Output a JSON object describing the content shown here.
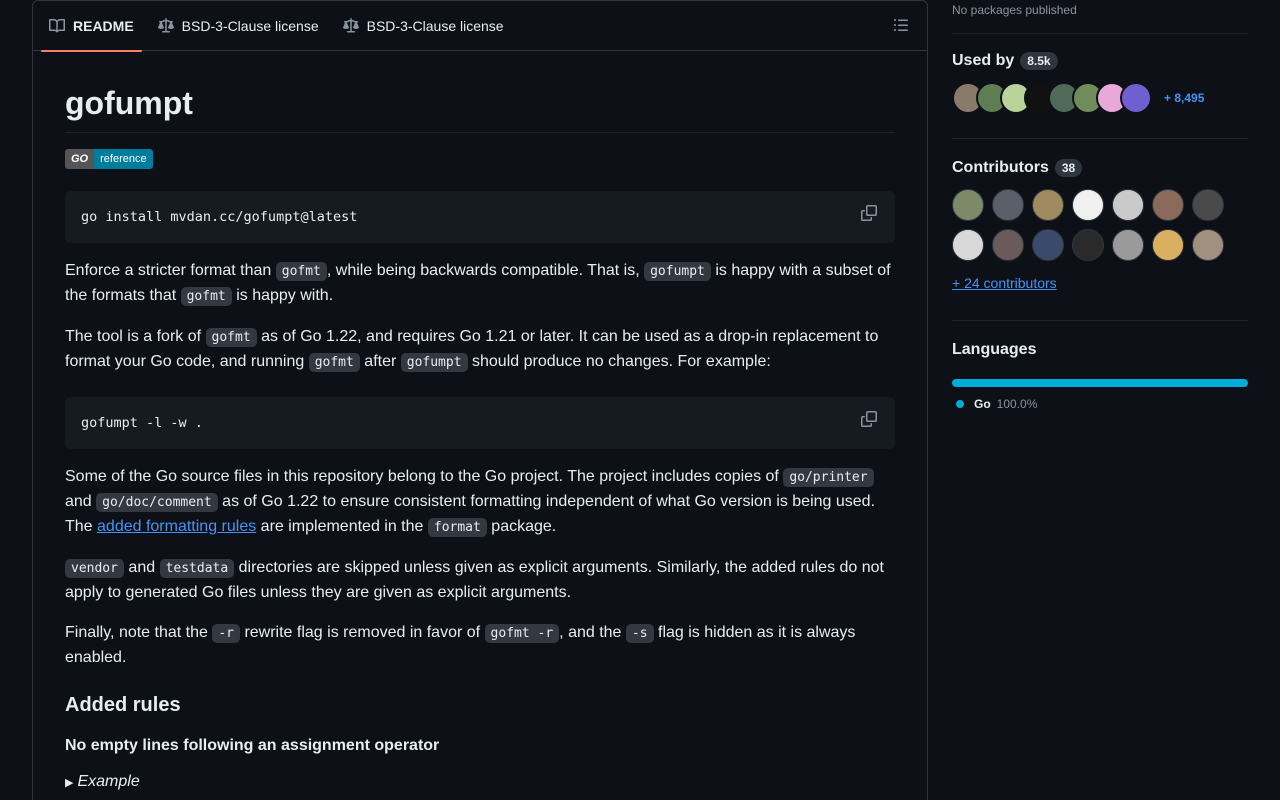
{
  "readme": {
    "tabs": [
      {
        "label": "README",
        "icon": "book-icon"
      },
      {
        "label": "BSD-3-Clause license",
        "icon": "law-icon"
      },
      {
        "label": "BSD-3-Clause license",
        "icon": "law-icon"
      }
    ],
    "title": "gofumpt",
    "badge": {
      "left": "GO",
      "right": "reference"
    },
    "code1": "go install mvdan.cc/gofumpt@latest",
    "p1": {
      "a": "Enforce a stricter format than ",
      "c1": "gofmt",
      "b": ", while being backwards compatible. That is, ",
      "c2": "gofumpt",
      "c": " is happy with a subset of the formats that ",
      "c3": "gofmt",
      "d": " is happy with."
    },
    "p2": {
      "a": "The tool is a fork of ",
      "c1": "gofmt",
      "b": " as of Go 1.22, and requires Go 1.21 or later. It can be used as a drop-in replacement to format your Go code, and running ",
      "c2": "gofmt",
      "c": " after ",
      "c3": "gofumpt",
      "d": " should produce no changes. For example:"
    },
    "code2": "gofumpt -l -w .",
    "p3": {
      "a": "Some of the Go source files in this repository belong to the Go project. The project includes copies of ",
      "c1": "go/printer",
      "b": " and ",
      "c2": "go/doc/comment",
      "c": " as of Go 1.22 to ensure consistent formatting independent of what Go version is being used. The ",
      "link": "added formatting rules",
      "d": " are implemented in the ",
      "c3": "format",
      "e": " package."
    },
    "p4": {
      "c1": "vendor",
      "a": " and ",
      "c2": "testdata",
      "b": " directories are skipped unless given as explicit arguments. Similarly, the added rules do not apply to generated Go files unless they are given as explicit arguments."
    },
    "p5": {
      "a": "Finally, note that the ",
      "c1": "-r",
      "b": " rewrite flag is removed in favor of ",
      "c2": "gofmt -r",
      "c": ", and the ",
      "c3": "-s",
      "d": " flag is hidden as it is always enabled."
    },
    "h2": "Added rules",
    "h3": "No empty lines following an assignment operator",
    "details": "Example"
  },
  "sidebar": {
    "packages_text": "No packages published",
    "used_by": {
      "label": "Used by",
      "count": "8.5k",
      "more": "+ 8,495"
    },
    "contributors": {
      "label": "Contributors",
      "count": "38",
      "more": "+ 24 contributors"
    },
    "languages": {
      "label": "Languages",
      "items": [
        {
          "name": "Go",
          "percent": "100.0%",
          "color": "#00add8"
        }
      ]
    }
  },
  "colors": {
    "accent": "#f78166",
    "link": "#4493f8",
    "go": "#00add8"
  }
}
